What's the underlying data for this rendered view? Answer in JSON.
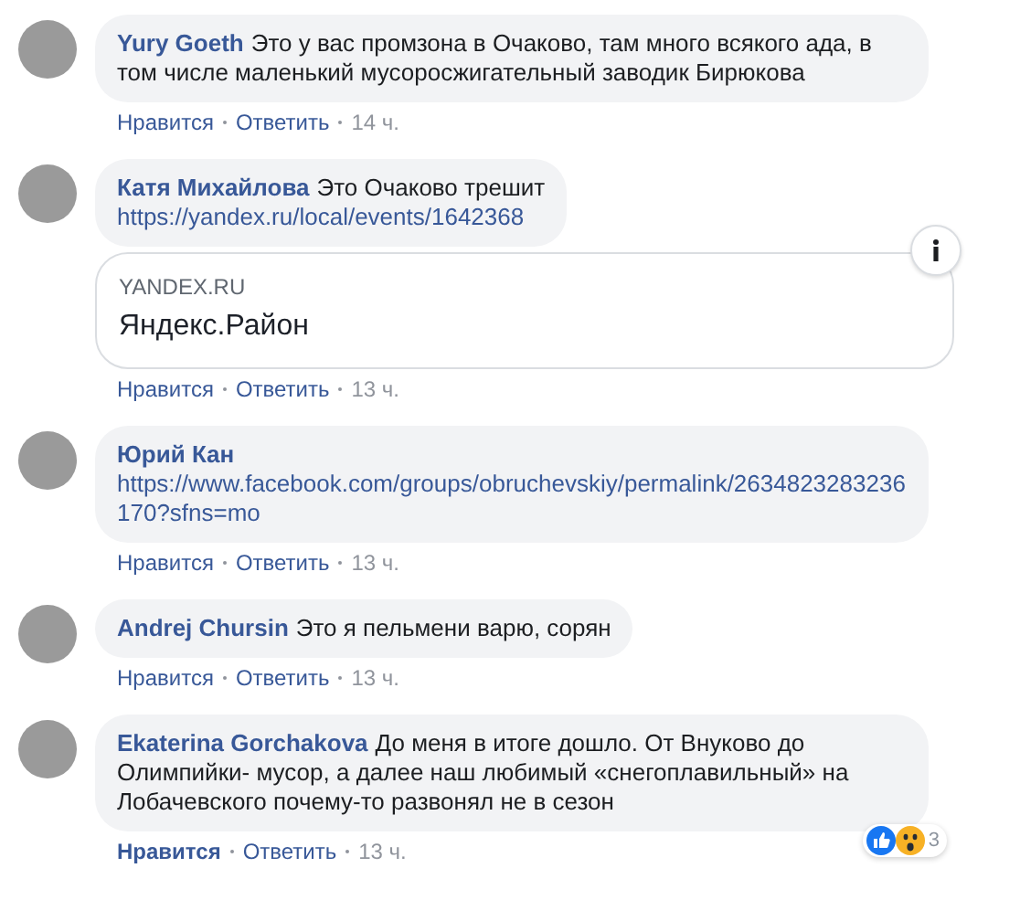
{
  "comments": [
    {
      "author": "Yury Goeth",
      "text": "Это у вас промзона в Очаково, там много всякого ада, в том числе маленький мусоросжигательный заводик Бирюкова",
      "like": "Нравится",
      "reply": "Ответить",
      "time": "14 ч.",
      "liked": false
    },
    {
      "author": "Катя Михайлова",
      "text": "Это Очаково трешит",
      "link": "https://yandex.ru/local/events/1642368",
      "preview": {
        "domain": "YANDEX.RU",
        "title": "Яндекс.Район"
      },
      "like": "Нравится",
      "reply": "Ответить",
      "time": "13 ч.",
      "liked": false
    },
    {
      "author": "Юрий Кан",
      "link": "https://www.facebook.com/groups/obruchevskiy/permalink/2634823283236170?sfns=mo",
      "like": "Нравится",
      "reply": "Ответить",
      "time": "13 ч.",
      "liked": false
    },
    {
      "author": "Andrej Chursin",
      "text": "Это я пельмени варю, сорян",
      "like": "Нравится",
      "reply": "Ответить",
      "time": "13 ч.",
      "liked": false
    },
    {
      "author": "Ekaterina Gorchakova",
      "text": "До меня в итоге дошло. От Внуково до Олимпийки- мусор, а далее наш любимый «снегоплавильный» на Лобачевского почему-то развонял не в сезон",
      "like": "Нравится",
      "reply": "Ответить",
      "time": "13 ч.",
      "liked": true,
      "reactions": {
        "count": "3"
      }
    }
  ]
}
